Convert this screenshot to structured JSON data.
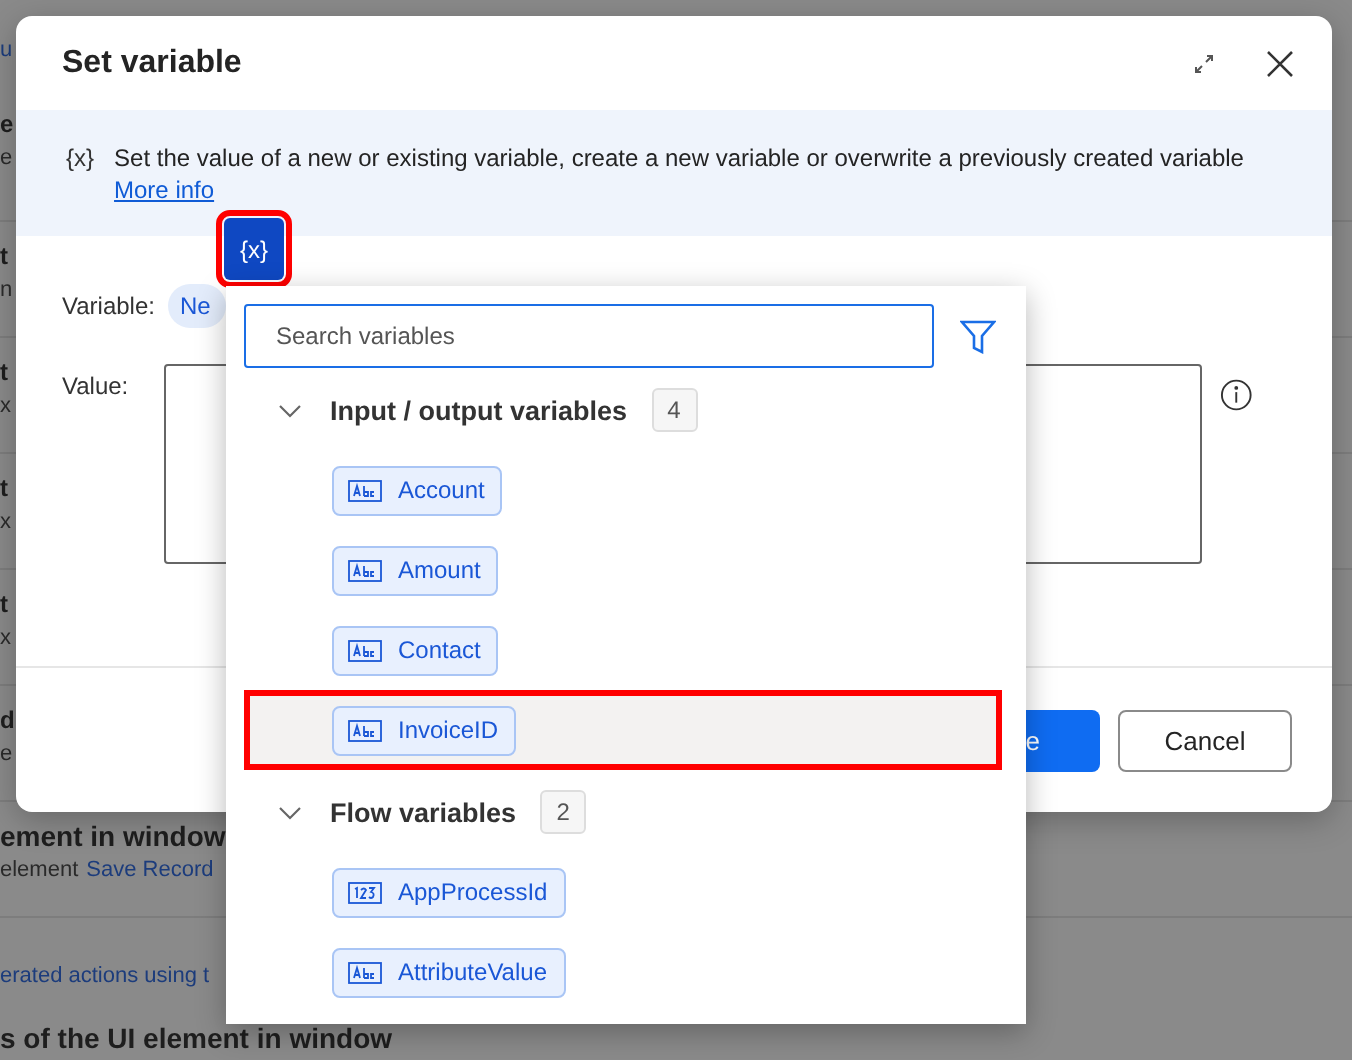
{
  "background": {
    "link_fragment": "u",
    "cards": [
      {
        "title": "e",
        "subtitle": "e"
      },
      {
        "title": "t",
        "subtitle": "n"
      },
      {
        "title": "t",
        "subtitle": "x"
      },
      {
        "title": "t",
        "subtitle": "x"
      },
      {
        "title": "t",
        "subtitle": "x"
      },
      {
        "title": "d",
        "subtitle": "e"
      },
      {
        "title": "ement in window",
        "subtitle": "element",
        "link": "Save Record"
      }
    ],
    "section_link": "erated actions using t",
    "section_title": "s of the UI element in window"
  },
  "dialog": {
    "title": "Set variable",
    "description_icon": "{x}",
    "description": "Set the value of a new or existing variable, create a new variable or overwrite a previously created variable",
    "more_info": "More info",
    "variable_label": "Variable:",
    "variable_chip": "Ne",
    "value_label": "Value:",
    "buttons": [
      {
        "label": "e",
        "kind": "primary"
      },
      {
        "label": "Cancel",
        "kind": "secondary"
      }
    ]
  },
  "variable_button": {
    "label": "{x}",
    "highlighted": true
  },
  "picker": {
    "search": {
      "placeholder": "Search variables"
    },
    "groups": [
      {
        "title": "Input / output variables",
        "count": "4",
        "expanded": true,
        "variables": [
          {
            "name": "Account",
            "kind": "text",
            "highlighted": false
          },
          {
            "name": "Amount",
            "kind": "text",
            "highlighted": false
          },
          {
            "name": "Contact",
            "kind": "text",
            "highlighted": false
          },
          {
            "name": "InvoiceID",
            "kind": "text",
            "highlighted": true
          }
        ]
      },
      {
        "title": "Flow variables",
        "count": "2",
        "expanded": true,
        "variables": [
          {
            "name": "AppProcessId",
            "kind": "number",
            "highlighted": false
          },
          {
            "name": "AttributeValue",
            "kind": "text",
            "highlighted": false
          }
        ]
      }
    ]
  }
}
